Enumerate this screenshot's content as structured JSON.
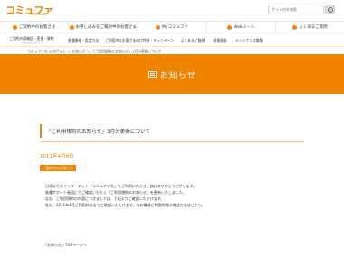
{
  "header": {
    "logo_text": "コミュファ",
    "logo_sub": "commufa",
    "search_placeholder": "サイト内を検索"
  },
  "main_nav": [
    {
      "label": "ご契約中のお客さま"
    },
    {
      "label": "お申し込みをご検討中のお客さま"
    },
    {
      "label": "Myコミュファ"
    },
    {
      "label": "Webメール"
    },
    {
      "label": "よくあるご質問"
    }
  ],
  "sub_nav": {
    "first_label": "ご契約内容確認・変更・解約",
    "first_sub": "(Myコミュファ)",
    "items": [
      {
        "label": "各種連絡・設定方法"
      },
      {
        "label": "ご利用中のお客さま向け特典・キャンペーン"
      },
      {
        "label": "よくあるご質問"
      },
      {
        "label": "障害情報"
      },
      {
        "label": "メンテナンス情報"
      }
    ]
  },
  "breadcrumb": "コミュファ光 公式サイト ＞ お知らせ ＞ 「ご利用規約のお知らせ」3月分更新について",
  "banner": {
    "title": "お知らせ"
  },
  "article": {
    "title": "「ご利用規約のお知らせ」3月分更新について",
    "date": "2011年4月8日",
    "tag": "ご契約中のお客さま",
    "paragraphs": [
      "日頃より光インターネット「コミュファ光」をご利用いただき、誠にありがとうございます。",
      "各種サポート画面にてご確認いただく「ご利用規約のお知らせ」を更新いたしました。",
      "なお、ご利用規約の内容につきましては、下記よりご確認いただけます。",
      "既お、2011年1月ご利用料金までご確認いただけます。なお電話ご利用明細の確認方法はこちら。"
    ]
  },
  "footer": {
    "link": "「お知らせ」TOPページへ"
  },
  "colors": {
    "accent": "#f08300"
  }
}
